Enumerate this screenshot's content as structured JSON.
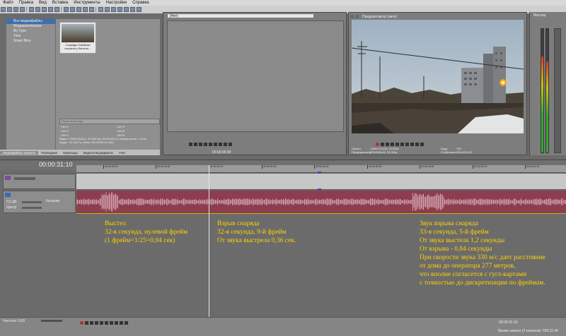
{
  "menu": [
    "Файл",
    "Правка",
    "Вид",
    "Вставка",
    "Инструменты",
    "Настройки",
    "Справка"
  ],
  "explorer": {
    "tree": [
      "Все медиафайлы",
      "Медиаколлекции",
      "By Type",
      "Теги",
      "Smart Bins"
    ],
    "thumb_caption": "Снаряды бойовики влучили у багатоп...",
    "search_placeholder": "Поиск всей ходи",
    "shortcuts": [
      "Ctrl+1",
      "Ctrl+4",
      "Ctrl+2",
      "Ctrl+5",
      "Ctrl+3",
      "Ctrl+6"
    ],
    "props": [
      "Видео: 1280x720x12, 25,000 fps, 00:00:48:14, Альфа-канал = Отсу",
      "Аудио: 44 100 Гц, Моно; 00:00:48:14, AAC"
    ],
    "tabs": [
      "Медиафайлы проекта",
      "Проводник",
      "Переходы",
      "Видеоспецэффекты",
      "Генс"
    ]
  },
  "trimmer": {
    "dropdown": "(Нет)",
    "timecode": "00:00:00:00"
  },
  "preview": {
    "mode_label": "Предпросмотр (авто)",
    "info": {
      "project": "Проект:",
      "project_val": "1280x720x32; 25,000p",
      "preview": "Предпросмотр:",
      "preview_val": "320x180x32; 25,000p",
      "frame": "Кадр:",
      "frame_val": "785",
      "display": "Отобразить:",
      "display_val": "393x224x32"
    }
  },
  "master": {
    "label": "Мастер",
    "levels": [
      0.78,
      0.74
    ]
  },
  "timeline": {
    "timecode": "00:00:31:10",
    "ticks": [
      "00:00:31:00",
      "00:00:31:05",
      "00:00:31:10",
      "00:00:31:15",
      "00:00:31:20",
      "00:00:32:00",
      "00:00:32:05",
      "00:00:32:10",
      "00:00:32:15",
      "00:00:32:20",
      "00:00:33:00"
    ],
    "audio_track": {
      "volume": "0,0 дБ",
      "mode": "Касание",
      "pan": "Центр"
    }
  },
  "annotations": {
    "left": [
      "Выстел",
      "32-я секунда, нулевой фрейм",
      "(1 фрейм=1/25=0,04 сек)"
    ],
    "middle": [
      "Взрыв снаряда",
      "32-я секунда, 9-й фрейм",
      "От звука выстрела 0,36 сек."
    ],
    "right": [
      "Звук взрыва снаряда",
      "33-я секунда, 5-й фрейм",
      "От звука выстела 1,2 секунды",
      "От взрыва - 0,84 секунды",
      "При скорости звука 330 м/с дает расстояние",
      "от дома до оператора 277 метров,",
      "что вполне согласется с гугл-картами",
      "с точностью до дискретизации по фреймам."
    ]
  },
  "bottom": {
    "rate": "Частота: 0,00",
    "timecode": "00:00:31:10",
    "record_time": "Время записи (2 каналов): 593:11:40"
  }
}
